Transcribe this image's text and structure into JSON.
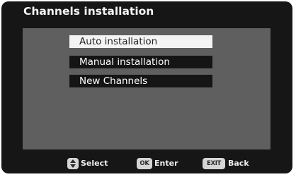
{
  "title": "Channels installation",
  "menu": {
    "items": [
      {
        "label": "Auto installation",
        "selected": true
      },
      {
        "label": "Manual installation",
        "selected": false
      },
      {
        "label": "New Channels",
        "selected": false
      }
    ]
  },
  "footer": {
    "select": {
      "key_icon": "up-down-arrows-icon",
      "label": "Select"
    },
    "ok": {
      "key": "OK",
      "label": "Enter"
    },
    "exit": {
      "key": "EXIT",
      "label": "Back"
    }
  }
}
